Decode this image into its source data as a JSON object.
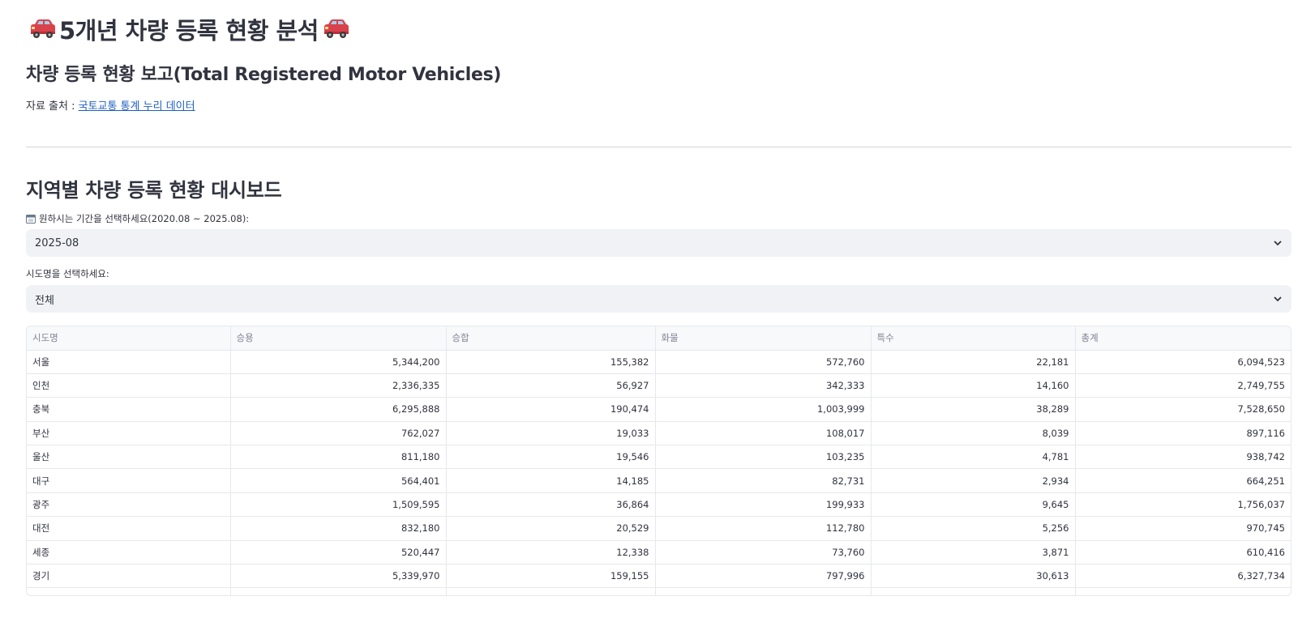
{
  "header": {
    "title": "5개년 차량 등록 현황 분석",
    "subtitle": "차량 등록 현황 보고(Total Registered Motor Vehicles)",
    "source_prefix": "자료 출처 : ",
    "source_link": "국토교통 통계 누리 데이터",
    "icon": "car-icon"
  },
  "dashboard": {
    "section_title": "지역별 차량 등록 현황 대시보드",
    "period_label": "원하시는 기간을 선택하세요(2020.08 ~ 2025.08):",
    "period_value": "2025-08",
    "region_label": "시도명을 선택하세요:",
    "region_value": "전체"
  },
  "table": {
    "columns": [
      "시도명",
      "승용",
      "승합",
      "화물",
      "특수",
      "총계"
    ],
    "rows": [
      [
        "서울",
        "5,344,200",
        "155,382",
        "572,760",
        "22,181",
        "6,094,523"
      ],
      [
        "인천",
        "2,336,335",
        "56,927",
        "342,333",
        "14,160",
        "2,749,755"
      ],
      [
        "충북",
        "6,295,888",
        "190,474",
        "1,003,999",
        "38,289",
        "7,528,650"
      ],
      [
        "부산",
        "762,027",
        "19,033",
        "108,017",
        "8,039",
        "897,116"
      ],
      [
        "울산",
        "811,180",
        "19,546",
        "103,235",
        "4,781",
        "938,742"
      ],
      [
        "대구",
        "564,401",
        "14,185",
        "82,731",
        "2,934",
        "664,251"
      ],
      [
        "광주",
        "1,509,595",
        "36,864",
        "199,933",
        "9,645",
        "1,756,037"
      ],
      [
        "대전",
        "832,180",
        "20,529",
        "112,780",
        "5,256",
        "970,745"
      ],
      [
        "세종",
        "520,447",
        "12,338",
        "73,760",
        "3,871",
        "610,416"
      ],
      [
        "경기",
        "5,339,970",
        "159,155",
        "797,996",
        "30,613",
        "6,327,734"
      ]
    ]
  },
  "colors": {
    "text": "#31333f",
    "link": "#1f5fc1",
    "select_bg": "#f0f2f6",
    "car_body": "#d9424b"
  }
}
